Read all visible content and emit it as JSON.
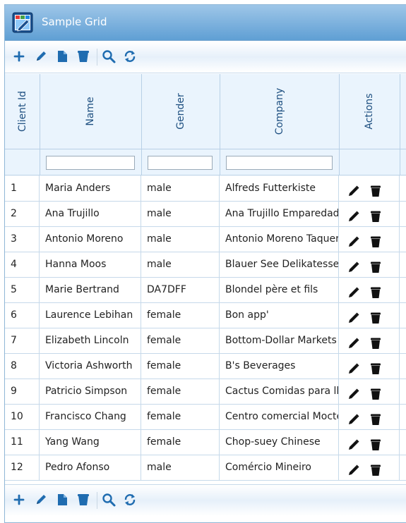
{
  "window": {
    "title": "Sample Grid",
    "icon": "grid-app-icon"
  },
  "toolbar": {
    "buttons": [
      {
        "name": "add",
        "icon": "plus-icon"
      },
      {
        "name": "edit",
        "icon": "pencil-icon"
      },
      {
        "name": "view",
        "icon": "document-icon"
      },
      {
        "name": "delete",
        "icon": "trash-icon"
      },
      {
        "name": "search",
        "icon": "search-icon"
      },
      {
        "name": "refresh",
        "icon": "refresh-icon"
      }
    ]
  },
  "columns": [
    "Client Id",
    "Name",
    "Gender",
    "Company",
    "Actions"
  ],
  "filters": {
    "name": "",
    "gender": "",
    "company": ""
  },
  "rows": [
    {
      "id": "1",
      "name": "Maria Anders",
      "gender": "male",
      "company": "Alfreds Futterkiste"
    },
    {
      "id": "2",
      "name": "Ana Trujillo",
      "gender": "male",
      "company": "Ana Trujillo Emparedados"
    },
    {
      "id": "3",
      "name": "Antonio Moreno",
      "gender": "male",
      "company": "Antonio Moreno Taquería"
    },
    {
      "id": "4",
      "name": "Hanna Moos",
      "gender": "male",
      "company": "Blauer See Delikatessen"
    },
    {
      "id": "5",
      "name": "Marie Bertrand",
      "gender": "DA7DFF",
      "company": "Blondel père et fils"
    },
    {
      "id": "6",
      "name": "Laurence Lebihan",
      "gender": "female",
      "company": "Bon app'"
    },
    {
      "id": "7",
      "name": "Elizabeth Lincoln",
      "gender": "female",
      "company": "Bottom-Dollar Markets"
    },
    {
      "id": "8",
      "name": "Victoria Ashworth",
      "gender": "female",
      "company": "B's Beverages"
    },
    {
      "id": "9",
      "name": "Patricio Simpson",
      "gender": "female",
      "company": "Cactus Comidas para llevar"
    },
    {
      "id": "10",
      "name": "Francisco Chang",
      "gender": "female",
      "company": "Centro comercial Moctezuma"
    },
    {
      "id": "11",
      "name": "Yang Wang",
      "gender": "female",
      "company": "Chop-suey Chinese"
    },
    {
      "id": "12",
      "name": "Pedro Afonso",
      "gender": "male",
      "company": "Comércio Mineiro"
    }
  ],
  "row_actions": {
    "edit": "pencil-icon",
    "delete": "trash-icon"
  },
  "colors": {
    "header_text": "#1e4f80",
    "title_bar": "#5f9fd4",
    "icon": "#1f6cb0"
  }
}
